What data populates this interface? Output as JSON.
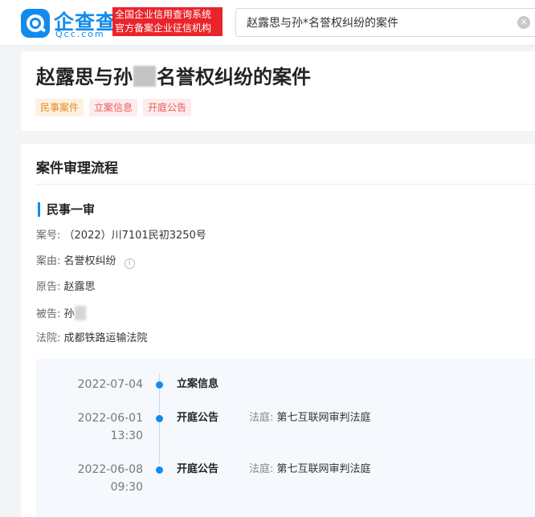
{
  "header": {
    "logo_cn": "企查查",
    "logo_en": "Qcc.com",
    "slogan_line1": "全国企业信用查询系统",
    "slogan_line2": "官方备案企业征信机构",
    "search_value": "赵露思与孙*名誉权纠纷的案件"
  },
  "case": {
    "title_prefix": "赵露思与孙",
    "title_suffix": "名誉权纠纷的案件",
    "tags": [
      "民事案件",
      "立案信息",
      "开庭公告"
    ]
  },
  "process": {
    "section_title": "案件审理流程",
    "stage_title": "民事一审",
    "case_no_label": "案号:",
    "case_no": "（2022）川7101民初3250号",
    "cause_label": "案由:",
    "cause": "名誉权纠纷",
    "plaintiff_label": "原告:",
    "plaintiff": "赵露思",
    "defendant_label": "被告:",
    "defendant": "孙",
    "court_label": "法院:",
    "court": "成都铁路运输法院"
  },
  "timeline": [
    {
      "date": "2022-07-04",
      "time": "",
      "type": "立案信息",
      "court_label": "",
      "court": ""
    },
    {
      "date": "2022-06-01",
      "time": "13:30",
      "type": "开庭公告",
      "court_label": "法庭:",
      "court": "第七互联网审判法庭"
    },
    {
      "date": "2022-06-08",
      "time": "09:30",
      "type": "开庭公告",
      "court_label": "法庭:",
      "court": "第七互联网审判法庭"
    }
  ],
  "colors": {
    "brand": "#128bed",
    "slogan_bg": "#e9242a",
    "tag_orange": "#ea8a1a",
    "tag_red": "#ec5b5b"
  }
}
